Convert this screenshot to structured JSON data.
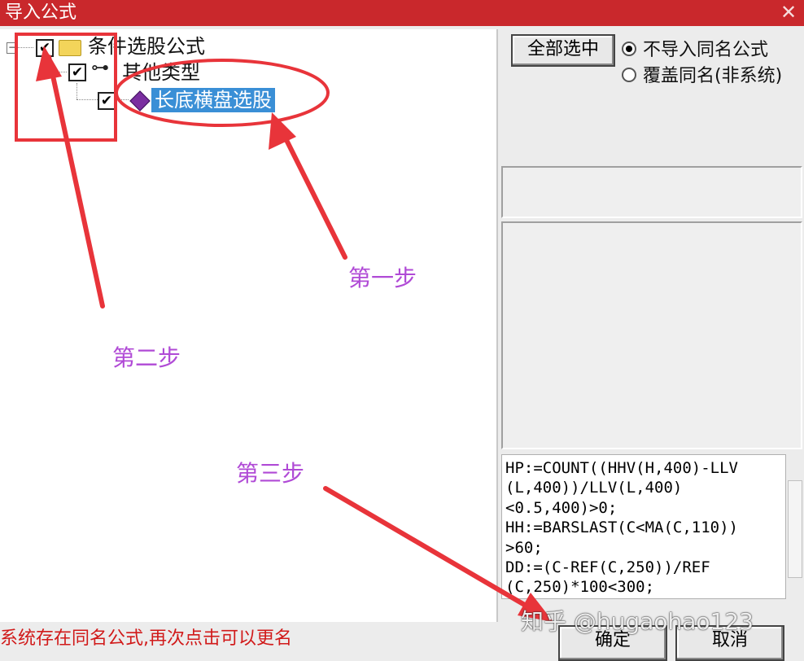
{
  "window": {
    "title": "导入公式"
  },
  "tree": {
    "root": {
      "label": "条件选股公式",
      "checked": true
    },
    "child": {
      "label": "其他类型",
      "checked": true
    },
    "leaf": {
      "label": "长底横盘选股",
      "checked": true,
      "selected": true
    }
  },
  "options": {
    "select_all_label": "全部选中",
    "radios": [
      {
        "label": "不导入同名公式",
        "selected": true
      },
      {
        "label": "覆盖同名(非系统)",
        "selected": false
      }
    ]
  },
  "formula": {
    "lines": [
      "HP:=COUNT((HHV(H,400)-LLV",
      "(L,400))/LLV(L,400)",
      "<0.5,400)>0;",
      "HH:=BARSLAST(C<MA(C,110))",
      ">60;",
      "DD:=(C-REF(C,250))/REF",
      "(C,250)*100<300;"
    ]
  },
  "status": {
    "message": "系统存在同名公式,再次点击可以更名"
  },
  "buttons": {
    "ok_label": "确定",
    "cancel_label": "取消"
  },
  "annotations": {
    "step1": "第一步",
    "step2": "第二步",
    "step3": "第三步"
  },
  "watermark": "知乎 @hugaohao123",
  "colors": {
    "titlebar": "#c9282c",
    "annotation": "#b04ad6",
    "arrow": "#e8343a",
    "status": "#d11a1a",
    "selection": "#3a8fd6"
  }
}
